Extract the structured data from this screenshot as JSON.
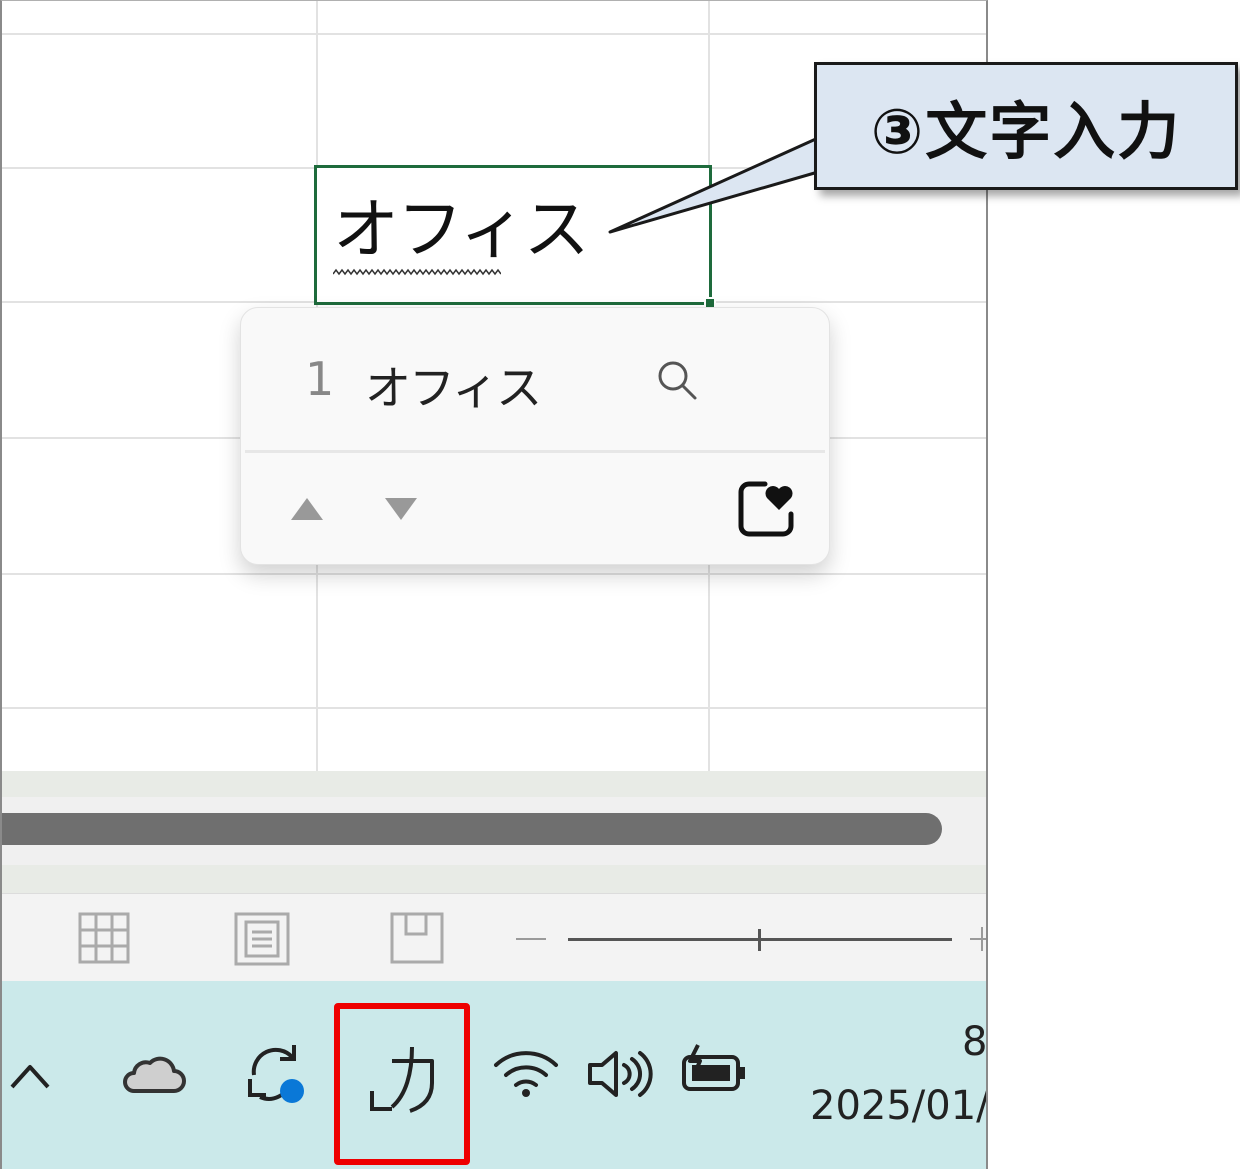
{
  "cell": {
    "text": "オフィス"
  },
  "ime_candidates": {
    "items": [
      {
        "number": "1",
        "text": "オフィス"
      }
    ],
    "icons": [
      "search-icon",
      "up-arrow-icon",
      "down-arrow-icon",
      "favorite-icon"
    ]
  },
  "status_bar": {
    "views": [
      "normal-view",
      "page-layout-view",
      "page-break-preview"
    ],
    "zoom": {
      "minus": "−",
      "plus": "+"
    }
  },
  "taskbar": {
    "icons": [
      "chevron-up-icon",
      "onedrive-cloud-icon",
      "sync-icon",
      "ime-mode-icon",
      "wifi-icon",
      "volume-icon",
      "battery-icon"
    ],
    "ime_mode_label": "_力",
    "clock_time": "8",
    "clock_date": "2025/01/"
  },
  "callout": {
    "text": "③文字入力"
  },
  "colors": {
    "cell_border": "#1e6b3c",
    "taskbar_bg": "#cbe9ea",
    "highlight_box": "#ee0000",
    "callout_bg": "#dce6f2",
    "sync_dot": "#0a78d7"
  }
}
